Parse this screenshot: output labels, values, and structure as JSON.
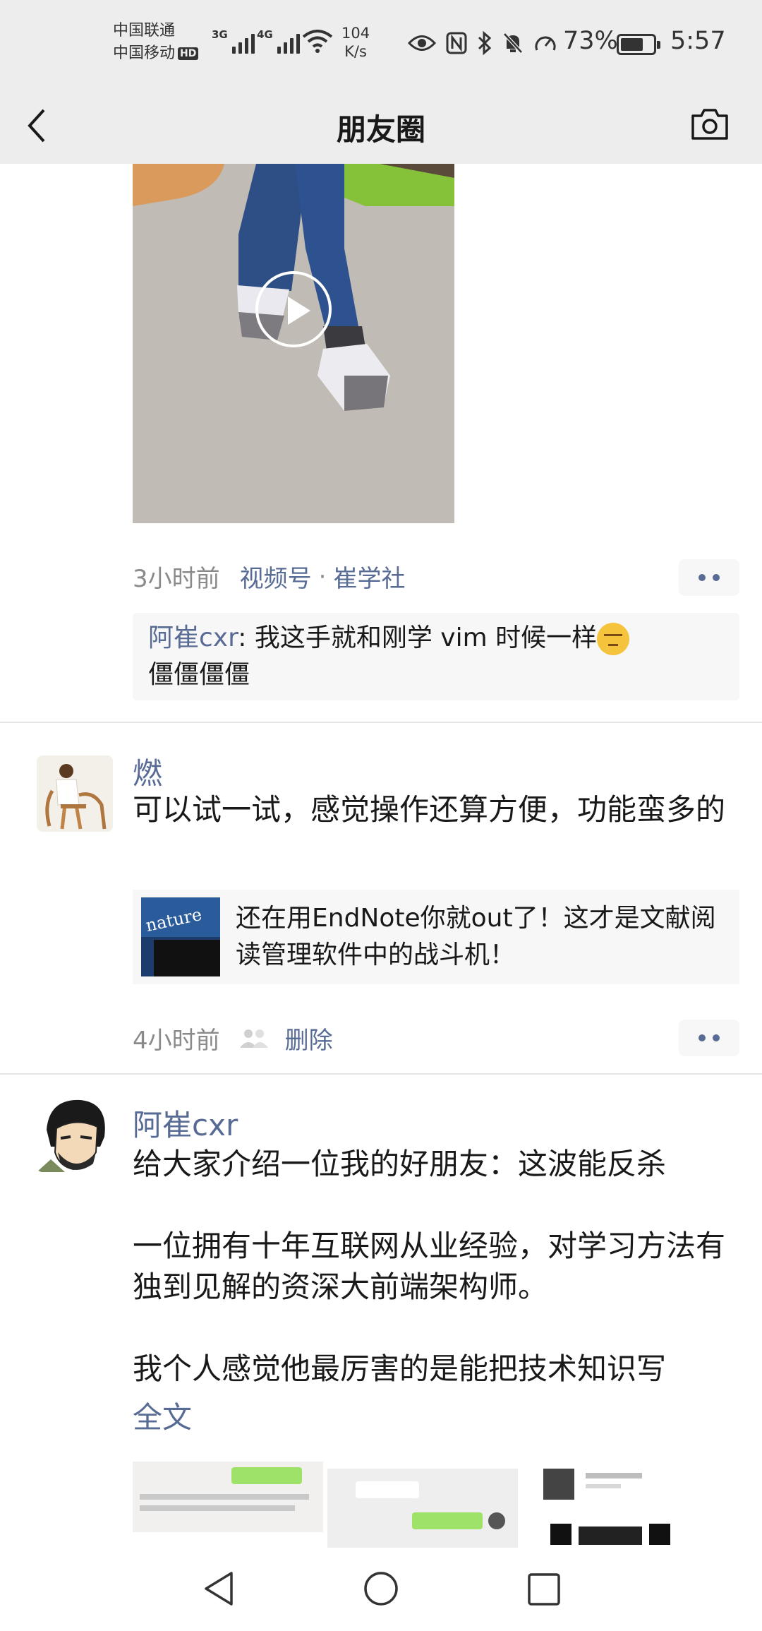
{
  "status_bar": {
    "carrier1": "中国联通",
    "carrier2": "中国移动",
    "hd": "HD",
    "sig1_gen": "3G",
    "sig2_gen": "4G",
    "net_speed_value": "104",
    "net_speed_unit": "K/s",
    "battery": "73%",
    "battery_level": 0.73,
    "time": "5:57"
  },
  "header": {
    "title": "朋友圈"
  },
  "post1": {
    "time": "3小时前",
    "channel": "视频号",
    "sep": "·",
    "source": "崔学社",
    "comment_author": "阿崔cxr",
    "comment_text": ": 我这手就和刚学 vim 时候一样",
    "comment_text2": "僵僵僵僵"
  },
  "post2": {
    "author": "燃",
    "text": "可以试一试，感觉操作还算方便，功能蛮多的",
    "share_title": "还在用EndNote你就out了！这才是文献阅读管理软件中的战斗机！",
    "thumb_text": "nature",
    "time": "4小时前",
    "delete": "删除"
  },
  "post3": {
    "author": "阿崔cxr",
    "text": "给大家介绍一位我的好朋友：这波能反杀\n\n一位拥有十年互联网从业经验，对学习方法有独到见解的资深大前端架构师。\n\n我个人感觉他最厉害的是能把技术知识写",
    "full": "全文"
  },
  "colors": {
    "link": "#576b95",
    "bar_bg": "#ededed"
  }
}
